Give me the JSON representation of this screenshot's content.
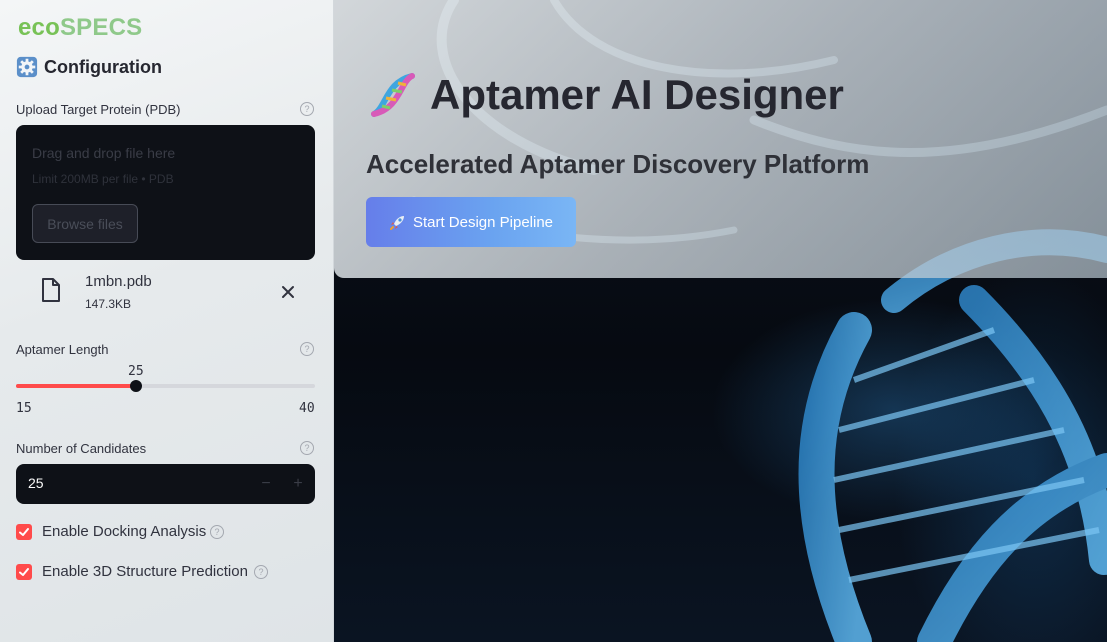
{
  "sidebar": {
    "brand_eco": "eco",
    "brand_specs": "SPECS",
    "config_title": "Configuration",
    "upload": {
      "label": "Upload Target Protein (PDB)",
      "drop_text": "Drag and drop file here",
      "limit_text": "Limit 200MB per file • PDB",
      "browse_label": "Browse files",
      "file_name": "1mbn.pdb",
      "file_size": "147.3KB"
    },
    "aptamer_length": {
      "label": "Aptamer Length",
      "value": "25",
      "min": "15",
      "max": "40",
      "fraction": 0.4
    },
    "candidates": {
      "label": "Number of Candidates",
      "value": "25",
      "minus": "−",
      "plus": "+"
    },
    "docking": {
      "label": "Enable Docking Analysis",
      "checked": true
    },
    "structure": {
      "label": "Enable 3D Structure Prediction",
      "checked": true
    },
    "help_glyph": "?"
  },
  "main": {
    "title": "Aptamer AI Designer",
    "subtitle": "Accelerated Aptamer Discovery Platform",
    "cta_label": "Start Design Pipeline"
  },
  "colors": {
    "accent": "#ff4b4b",
    "brand_green": "#78c257",
    "cta_start": "#667eea",
    "cta_end": "#7ab6f5"
  },
  "icons": {
    "gear": "gear-icon",
    "dna": "dna-icon",
    "rocket": "rocket-icon",
    "file": "file-icon",
    "close": "close-icon",
    "help": "help-icon",
    "check": "checkmark-icon"
  }
}
